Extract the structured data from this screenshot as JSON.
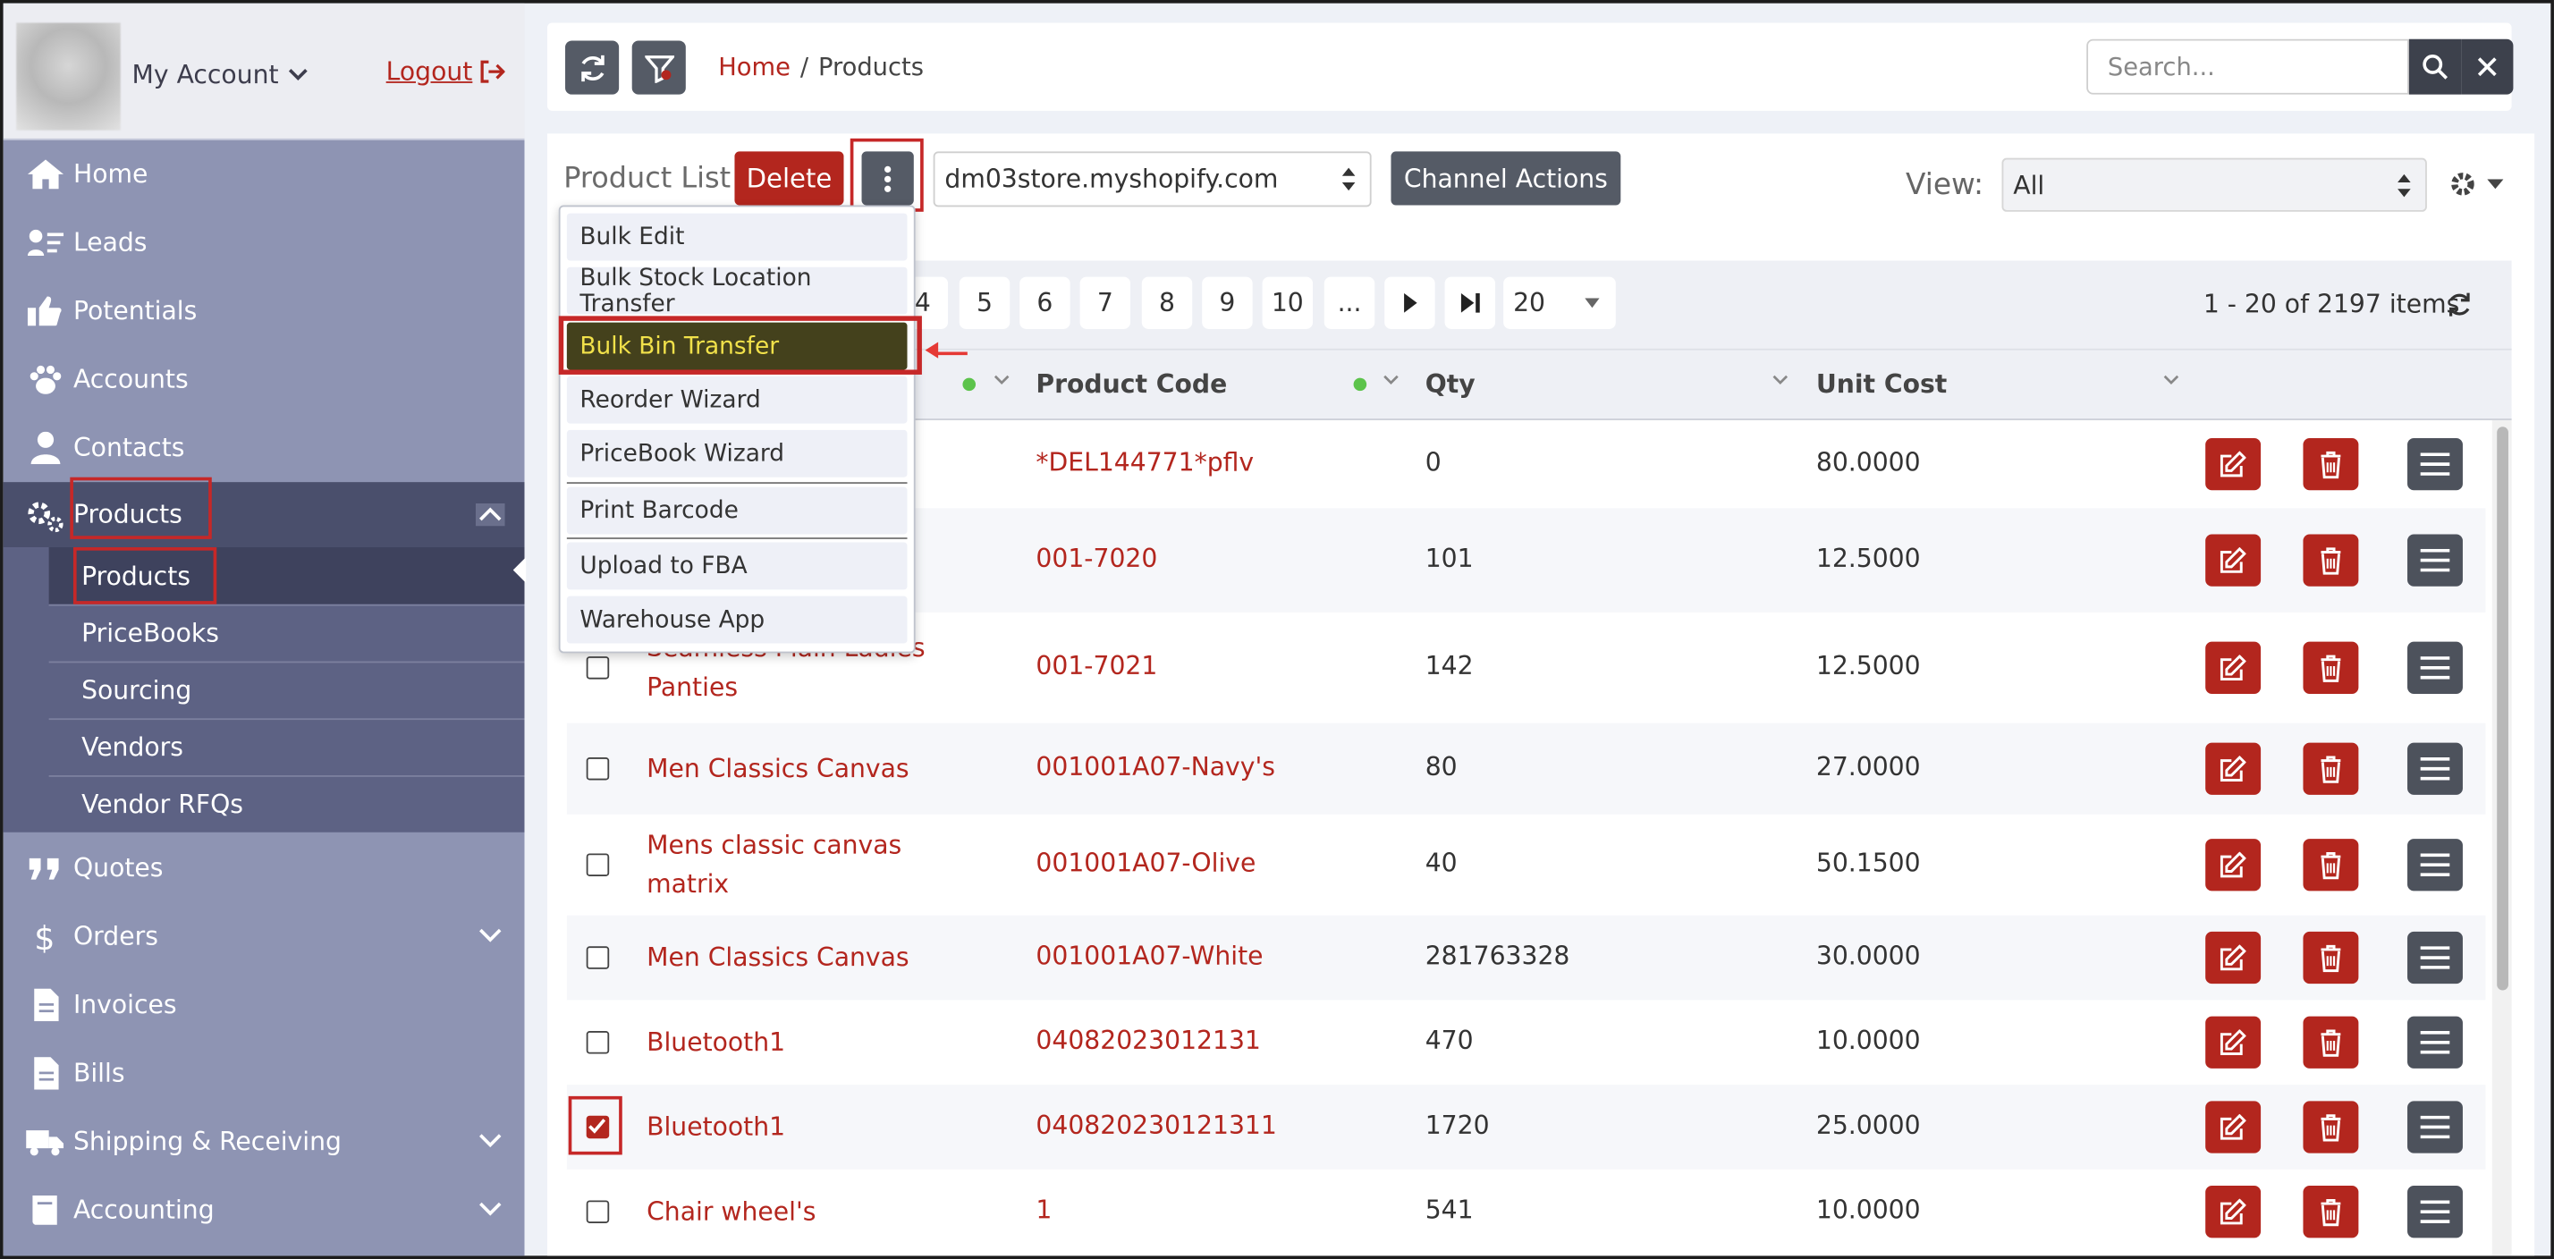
{
  "account": {
    "name": "My Account",
    "logout": "Logout"
  },
  "nav": {
    "home": "Home",
    "leads": "Leads",
    "potentials": "Potentials",
    "accounts": "Accounts",
    "contacts": "Contacts",
    "products": "Products",
    "quotes": "Quotes",
    "orders": "Orders",
    "invoices": "Invoices",
    "bills": "Bills",
    "shipping": "Shipping & Receiving",
    "accounting": "Accounting"
  },
  "subnav": [
    "Products",
    "PriceBooks",
    "Sourcing",
    "Vendors",
    "Vendor RFQs"
  ],
  "breadcrumb": {
    "home": "Home",
    "sep": "/",
    "current": "Products"
  },
  "search": {
    "placeholder": "Search..."
  },
  "toolbar": {
    "title": "Product List",
    "delete": "Delete",
    "store": "dm03store.myshopify.com",
    "channel_actions": "Channel Actions",
    "view_label": "View:",
    "view_value": "All"
  },
  "dropdown": [
    "Bulk Edit",
    "Bulk Stock Location Transfer",
    "Bulk Bin Transfer",
    "Reorder Wizard",
    "PriceBook Wizard",
    "Print Barcode",
    "Upload to FBA",
    "Warehouse App"
  ],
  "pager": {
    "pages": [
      "4",
      "5",
      "6",
      "7",
      "8",
      "9",
      "10",
      "..."
    ],
    "page_size": "20",
    "summary": "1 - 20 of 2197 items"
  },
  "columns": {
    "product_code": "Product Code",
    "qty": "Qty",
    "unit_cost": "Unit Cost"
  },
  "rows": [
    {
      "name": "",
      "code": "*DEL144771*pflv",
      "qty": "0",
      "cost": "80.0000",
      "checked": false
    },
    {
      "name": "",
      "code": "001-7020",
      "qty": "101",
      "cost": "12.5000",
      "checked": false
    },
    {
      "name": "Seamless Plain Ladies Panties",
      "code": "001-7021",
      "qty": "142",
      "cost": "12.5000",
      "checked": false
    },
    {
      "name": "Men Classics Canvas",
      "code": "001001A07-Navy's",
      "qty": "80",
      "cost": "27.0000",
      "checked": false
    },
    {
      "name": "Mens classic canvas matrix",
      "code": "001001A07-Olive",
      "qty": "40",
      "cost": "50.1500",
      "checked": false
    },
    {
      "name": "Men Classics Canvas",
      "code": "001001A07-White",
      "qty": "281763328",
      "cost": "30.0000",
      "checked": false
    },
    {
      "name": "Bluetooth1",
      "code": "04082023012131",
      "qty": "470",
      "cost": "10.0000",
      "checked": false
    },
    {
      "name": "Bluetooth1",
      "code": "040820230121311",
      "qty": "1720",
      "cost": "25.0000",
      "checked": true
    },
    {
      "name": "Chair wheel's",
      "code": "1",
      "qty": "541",
      "cost": "10.0000",
      "checked": false
    }
  ],
  "colors": {
    "sidebar": "#8e94b3",
    "accent": "#b3261e",
    "dark": "#555b66",
    "selected_bg": "#44411c",
    "selected_fg": "#f1e14a"
  }
}
